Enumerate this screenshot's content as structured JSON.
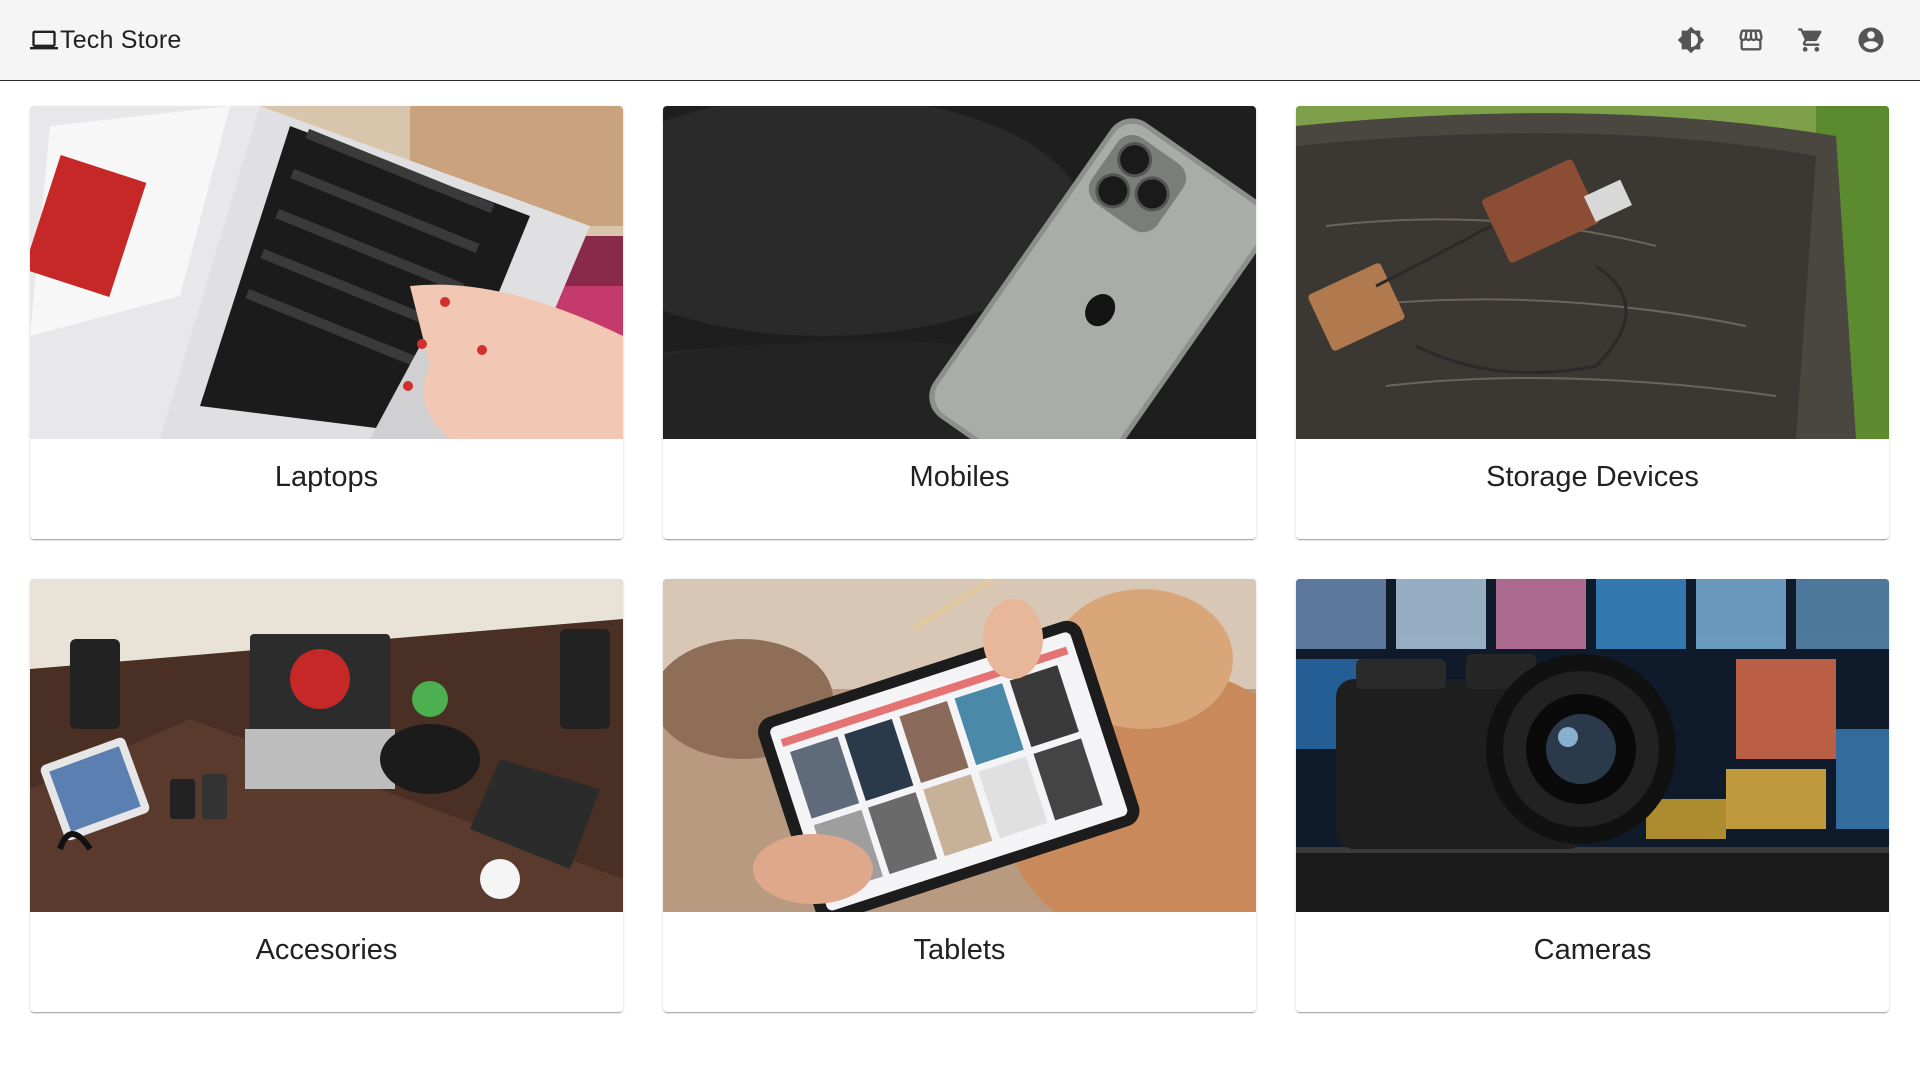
{
  "app": {
    "brand_label": "Tech Store",
    "brand_icon": "laptop-icon"
  },
  "header": {
    "actions": [
      {
        "name": "theme-toggle-button",
        "icon": "brightness-icon"
      },
      {
        "name": "store-button",
        "icon": "storefront-icon"
      },
      {
        "name": "cart-button",
        "icon": "cart-icon"
      },
      {
        "name": "account-button",
        "icon": "account-circle-icon"
      }
    ]
  },
  "categories": [
    {
      "label": "Laptops",
      "image": "laptop-photo"
    },
    {
      "label": "Mobiles",
      "image": "phone-photo"
    },
    {
      "label": "Storage Devices",
      "image": "usb-drive-photo"
    },
    {
      "label": "Accesories",
      "image": "desk-accessories-photo"
    },
    {
      "label": "Tablets",
      "image": "tablet-photo"
    },
    {
      "label": "Cameras",
      "image": "camera-photo"
    }
  ],
  "colors": {
    "header_bg": "#f5f5f5",
    "text": "#212121",
    "icon": "#555555"
  }
}
